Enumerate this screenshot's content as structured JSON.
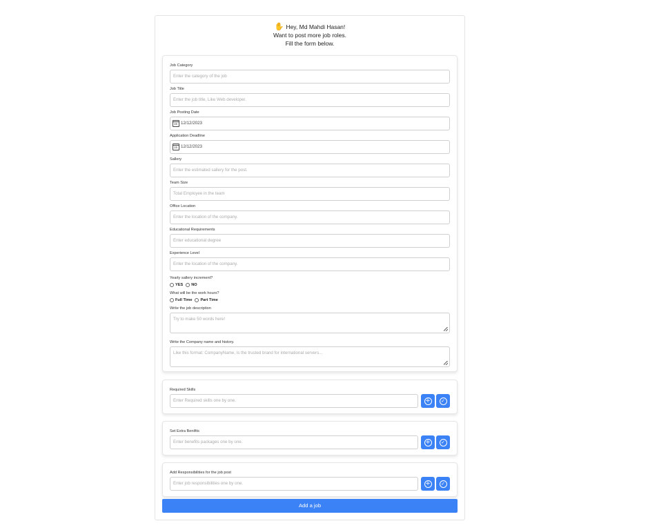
{
  "greeting": {
    "hand_icon": "waving-hand-icon",
    "line1": "Hey, Md Mahdi Hasan!",
    "line2": "Want to post more job roles.",
    "line3": "Fill the form below."
  },
  "form": {
    "job_category": {
      "label": "Job Category",
      "placeholder": "Enter the category of the job"
    },
    "job_title": {
      "label": "Job Title",
      "placeholder": "Enter the job title, Like Web developer."
    },
    "posting_date": {
      "label": "Job Posting Date",
      "value": "12/12/2023"
    },
    "deadline": {
      "label": "Application Deadline",
      "value": "12/12/2023"
    },
    "sallery": {
      "label": "Sallery",
      "placeholder": "Enter the estimated sallery for the post."
    },
    "team_size": {
      "label": "Team Size",
      "placeholder": "Total Employee in the team"
    },
    "office_location": {
      "label": "Office Location",
      "placeholder": "Enter the location of the company."
    },
    "education": {
      "label": "Educational Requirements",
      "placeholder": "Enter educational degree"
    },
    "experience": {
      "label": "Experience Level",
      "placeholder": "Enter the location of the company."
    },
    "increment": {
      "label": "Yearly sallery increment?",
      "options": [
        "YES",
        "NO"
      ]
    },
    "work_hours": {
      "label": "What will be the work hours?",
      "options": [
        "Full Time",
        "Part Time"
      ]
    },
    "description": {
      "label": "Write the job description",
      "placeholder": "Try to make 50 words here!"
    },
    "company": {
      "label": "Write the Company name and history.",
      "placeholder": "Like this format: CompanyName, is the trusted brand for international servers..."
    }
  },
  "skills": {
    "label": "Required Skills",
    "placeholder": "Enter Required skills one by one."
  },
  "benefits": {
    "label": "Set Extra Benifits",
    "placeholder": "Enter benefits packages one by one."
  },
  "responsibilities": {
    "label": "Add Responsibilities for the job post",
    "placeholder": "Enter job responsibilities one by one."
  },
  "submit_label": "Add a job",
  "colors": {
    "accent": "#3b82f6"
  }
}
